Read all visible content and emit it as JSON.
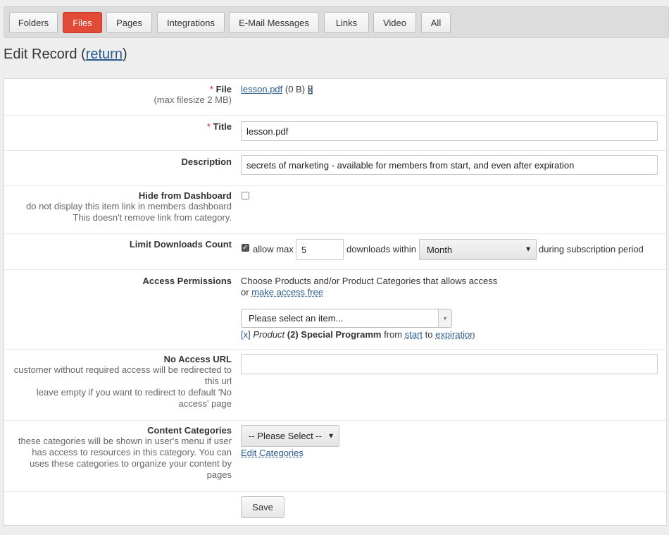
{
  "tabs": [
    {
      "label": "Folders",
      "active": false
    },
    {
      "label": "Files",
      "active": true
    },
    {
      "label": "Pages",
      "active": false
    },
    {
      "label": "Integrations",
      "active": false
    },
    {
      "label": "E-Mail Messages",
      "active": false
    },
    {
      "label": "Links",
      "active": false
    },
    {
      "label": "Video",
      "active": false
    },
    {
      "label": "All",
      "active": false
    }
  ],
  "heading": {
    "text": "Edit Record (",
    "link": "return",
    "close": ")"
  },
  "file": {
    "required_mark": "*",
    "label": "File",
    "help": "(max filesize 2 MB)",
    "filename": "lesson.pdf",
    "size": "(0 B)",
    "remove_open": "[",
    "remove": "x",
    "remove_close": "]"
  },
  "title": {
    "required_mark": "*",
    "label": "Title",
    "value": "lesson.pdf"
  },
  "description": {
    "label": "Description",
    "value": "secrets of marketing - available for members from start, and even after expiration"
  },
  "hide": {
    "label": "Hide from Dashboard",
    "help1": "do not display this item link in members dashboard",
    "help2": "This doesn't remove link from category.",
    "checked": false
  },
  "limit": {
    "label": "Limit Downloads Count",
    "checked": true,
    "allow_max": "allow max",
    "count": "5",
    "within": "downloads within",
    "period": "Month",
    "suffix": "during subscription period"
  },
  "access": {
    "label": "Access Permissions",
    "line1": "Choose Products and/or Product Categories that allows access",
    "or": "or",
    "make_free": "make access free",
    "placeholder": "Please select an item...",
    "item": {
      "remove": "[x]",
      "type": "Product",
      "name": "(2) Special Programm",
      "from": "from",
      "start": "start",
      "to": "to",
      "end": "expiration"
    }
  },
  "no_access": {
    "label": "No Access URL",
    "help": [
      "customer without required access will be redirected to",
      "this url",
      "leave empty if you want to redirect to default 'No",
      "access' page"
    ],
    "value": ""
  },
  "categories": {
    "label": "Content Categories",
    "help": [
      "these categories will be shown in user's menu if user",
      "has access to resources in this category. You can",
      "uses these categories to organize your content by",
      "pages"
    ],
    "select": "-- Please Select --",
    "edit_link": "Edit Categories"
  },
  "save_label": "Save"
}
